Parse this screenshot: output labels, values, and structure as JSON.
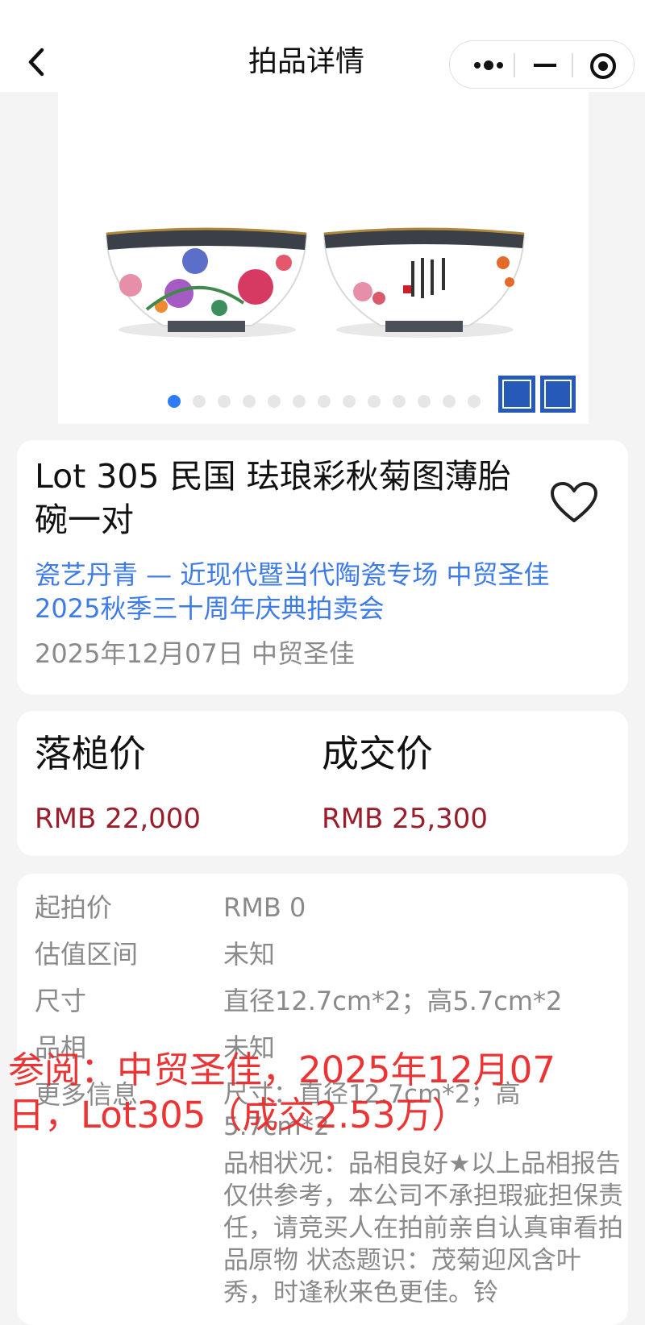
{
  "navbar": {
    "title": "拍品详情",
    "icons": [
      "back-icon",
      "more-dots-icon",
      "minimize-icon",
      "close-target-icon"
    ]
  },
  "carousel": {
    "slide_count": 13,
    "active_index": 0,
    "image_description_icons": [
      "bowls-image",
      "seal-mark-icon"
    ]
  },
  "lot": {
    "title": "Lot 305 民国 珐琅彩秋菊图薄胎碗一对",
    "sale_name": "瓷艺丹青 — 近现代暨当代陶瓷专场 中贸圣佳2025秋季三十周年庆典拍卖会",
    "date_house": "2025年12月07日 中贸圣佳",
    "favorite_icon": "heart-icon"
  },
  "prices": {
    "hammer_label": "落槌价",
    "hammer_value": "RMB 22,000",
    "deal_label": "成交价",
    "deal_value": "RMB 25,300",
    "price_color": "#9b1c2a"
  },
  "details": {
    "start_label": "起拍价",
    "start_value": "RMB 0",
    "estimate_label": "估值区间",
    "estimate_value": "未知",
    "size_label": "尺寸",
    "size_value": "直径12.7cm*2；高5.7cm*2",
    "condition_label": "品相",
    "condition_value": "未知",
    "more_label": "更多信息",
    "more_size": "尺寸：直径12.7cm*2；高5.7cm*2",
    "more_condition": "品相状况：品相良好★以上品相报告仅供参考，本公司不承担瑕疵担保责任，请竞买人在拍前亲自认真审看拍品原物 状态题识：茂菊迎风含叶秀，时逢秋来色更佳。铃"
  },
  "overlay": {
    "text": "参阅：中贸圣佳，2025年12月07日，Lot305（成交2.53万）",
    "color": "#ec2a2a"
  },
  "colors": {
    "accent": "#2f7df6",
    "link": "#3d7be8",
    "background": "#f4f4f4"
  }
}
